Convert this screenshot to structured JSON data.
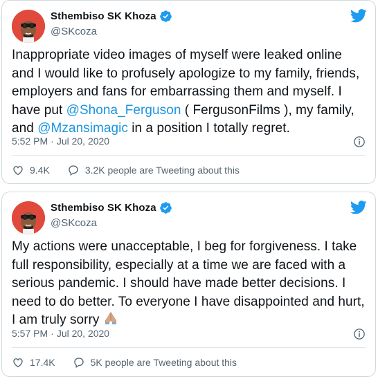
{
  "colors": {
    "link": "#1b95e0",
    "twitter_blue": "#1d9bf0",
    "secondary_text": "#536471",
    "avatar_bg": "#e04a3c"
  },
  "tweets": [
    {
      "author_name": "Sthembiso SK Khoza",
      "author_handle": "@SKcoza",
      "text_1": "Inappropriate video images of myself were leaked online and I would like to profusely apologize to my family, friends, employers and fans for embarrassing them and myself. I have put ",
      "mention_1": "@Shona_Ferguson",
      "text_2": " ( FergusonFilms ), my family, and ",
      "mention_2": "@Mzansimagic",
      "text_3": " in a position I totally regret.",
      "time": "5:52 PM",
      "date": "Jul 20, 2020",
      "like_count": "9.4K",
      "talking": "3.2K people are Tweeting about this",
      "icons": [
        "avatar",
        "verified-badge-icon",
        "twitter-bird-icon",
        "info-icon",
        "heart-icon",
        "speech-bubble-icon"
      ]
    },
    {
      "author_name": "Sthembiso SK Khoza",
      "author_handle": "@SKcoza",
      "text_1": "My actions were unacceptable, I beg for forgiveness. I take full responsibility, especially at a time we are faced with a serious pandemic. I should have made better decisions. I need to do better. To everyone I have disappointed and hurt, I am truly sorry ",
      "time": "5:57 PM",
      "date": "Jul 20, 2020",
      "like_count": "17.4K",
      "talking": "5K people are Tweeting about this",
      "icons": [
        "avatar",
        "verified-badge-icon",
        "twitter-bird-icon",
        "folded-hands-emoji-icon",
        "info-icon",
        "heart-icon",
        "speech-bubble-icon"
      ]
    }
  ]
}
